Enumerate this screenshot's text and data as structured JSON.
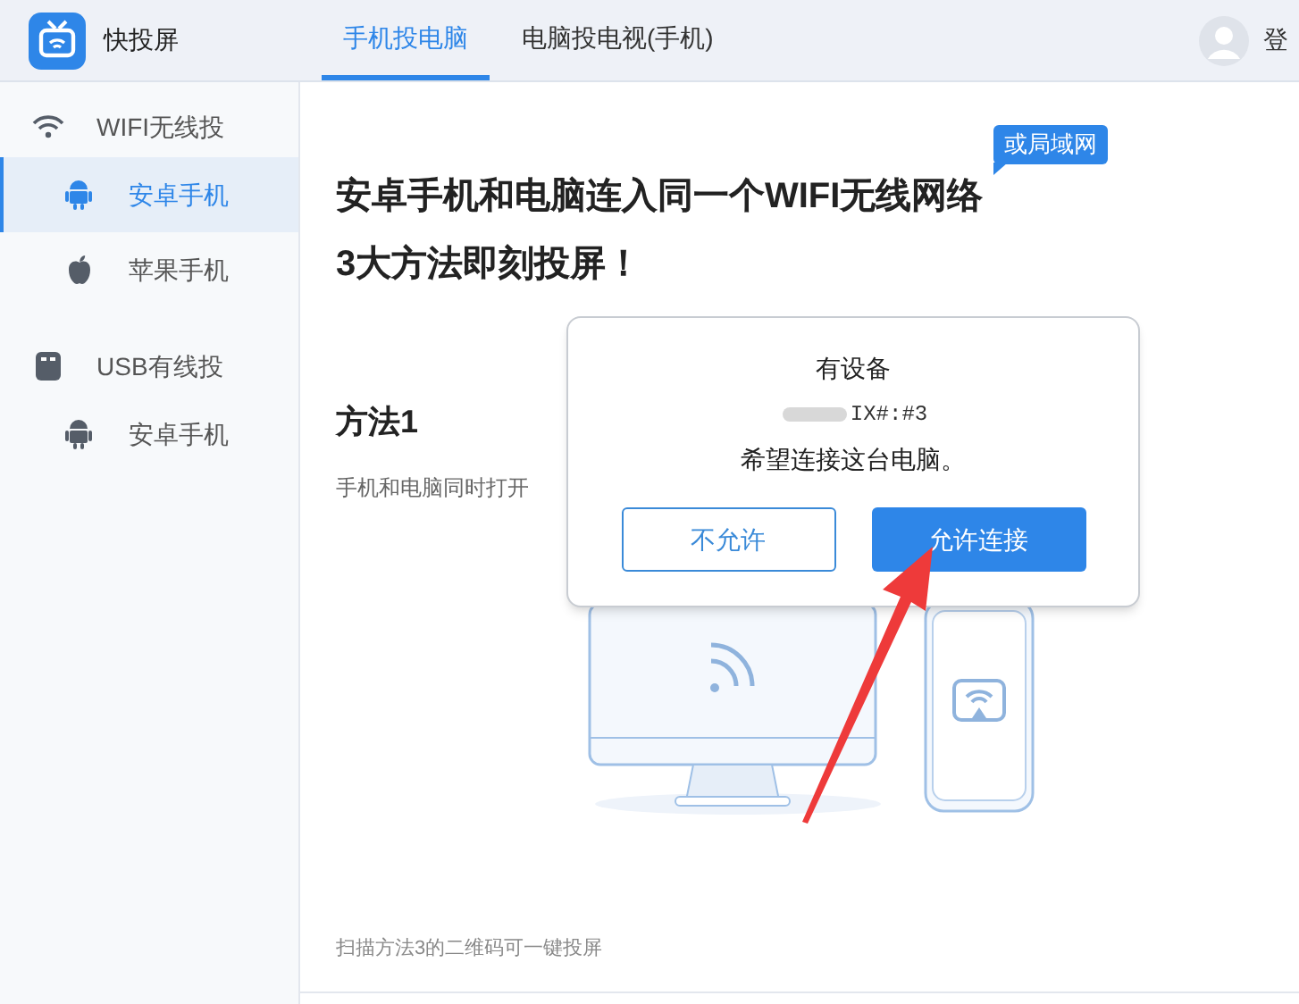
{
  "app": {
    "title": "快投屏"
  },
  "tabs": [
    {
      "label": "手机投电脑",
      "selected": true
    },
    {
      "label": "电脑投电视(手机)",
      "selected": false
    }
  ],
  "account": {
    "label": "登"
  },
  "sidebar": {
    "groups": [
      {
        "label": "WIFI无线投",
        "kind": "wifi",
        "children": [
          {
            "label": "安卓手机",
            "kind": "android",
            "selected": true
          },
          {
            "label": "苹果手机",
            "kind": "apple",
            "selected": false
          }
        ]
      },
      {
        "label": "USB有线投",
        "kind": "usb",
        "children": [
          {
            "label": "安卓手机",
            "kind": "android",
            "selected": false
          }
        ]
      }
    ]
  },
  "main": {
    "badge": "或局域网",
    "headline": [
      "安卓手机和电脑连入同一个WIFI无线网络",
      "3大方法即刻投屏！"
    ],
    "method_title": "方法1",
    "method_text": "手机和电脑同时打开",
    "footer_note": "扫描方法3的二维码可一键投屏"
  },
  "dialog": {
    "line_1": "有设备",
    "device": "IX#:#3",
    "line_2": "希望连接这台电脑。",
    "buttons": [
      {
        "label": "不允许",
        "kind": "secondary"
      },
      {
        "label": "允许连接",
        "kind": "primary"
      }
    ]
  }
}
